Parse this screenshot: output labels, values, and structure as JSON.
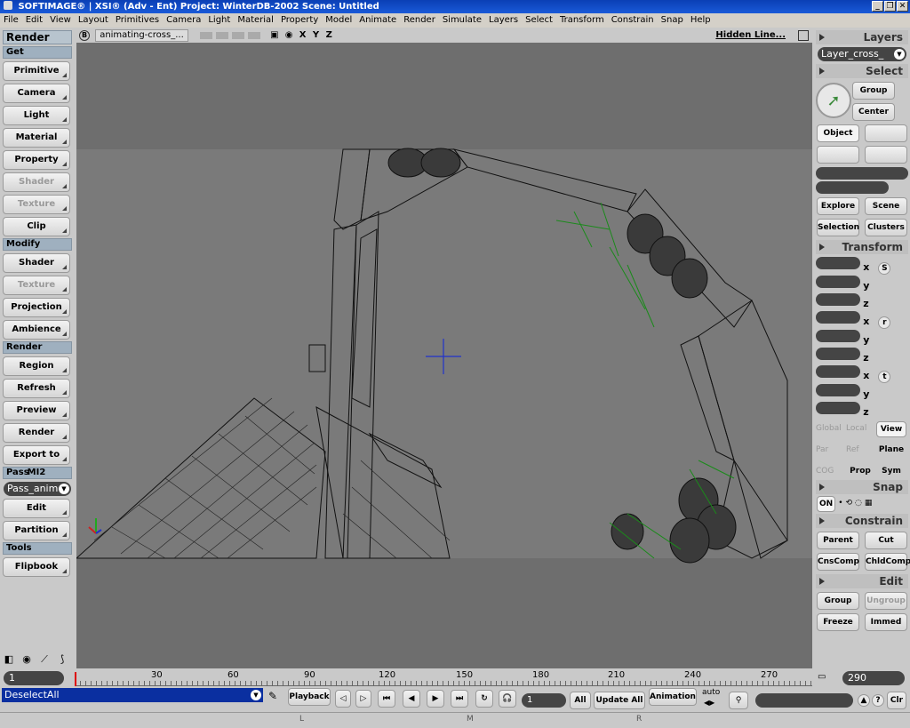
{
  "title": "SOFTIMAGE® | XSI® (Adv - Ent) Project: WinterDB-2002    Scene: Untitled",
  "menu": [
    "File",
    "Edit",
    "View",
    "Layout",
    "Primitives",
    "Camera",
    "Light",
    "Material",
    "Property",
    "Model",
    "Animate",
    "Render",
    "Simulate",
    "Layers",
    "Select",
    "Transform",
    "Constrain",
    "Snap",
    "Help"
  ],
  "left": {
    "title": "Render",
    "get_header": "Get",
    "get_buttons": [
      "Primitive",
      "Camera",
      "Light",
      "Material",
      "Property",
      "Shader",
      "Texture",
      "Clip"
    ],
    "modify_header": "Modify",
    "modify_buttons": [
      "Shader",
      "Texture",
      "Projection",
      "Ambience"
    ],
    "render_header": "Render",
    "render_buttons": [
      "Region",
      "Refresh",
      "Preview",
      "Render",
      "Export to MI2"
    ],
    "pass_header": "Pass",
    "pass_value": "Pass_anim",
    "pass_buttons": [
      "Edit",
      "Partition"
    ],
    "tools_header": "Tools",
    "tools_buttons": [
      "Flipbook"
    ]
  },
  "viewport": {
    "badge": "B",
    "camera": "animating-cross_...",
    "axes": "X Y Z",
    "mode": "Hidden Line..."
  },
  "right": {
    "layers_header": "Layers",
    "layer_value": "Layer_cross_",
    "select_header": "Select",
    "group": "Group",
    "center": "Center",
    "object": "Object",
    "explore": "Explore",
    "scene": "Scene",
    "selection": "Selection",
    "clusters": "Clusters",
    "transform_header": "Transform",
    "axis_x": "x",
    "axis_y": "y",
    "axis_z": "z",
    "s": "S",
    "r": "r",
    "t": "t",
    "global": "Global",
    "local": "Local",
    "view": "View",
    "par": "Par",
    "ref": "Ref",
    "plane": "Plane",
    "cog": "COG",
    "prop": "Prop",
    "sym": "Sym",
    "snap_header": "Snap",
    "snap_on": "ON",
    "constrain_header": "Constrain",
    "parent": "Parent",
    "cut": "Cut",
    "cnscomp": "CnsComp",
    "chldcomp": "ChldComp",
    "edit_header": "Edit",
    "edit_group": "Group",
    "ungroup": "Ungroup",
    "freeze": "Freeze",
    "immed": "Immed"
  },
  "timeline": {
    "start": "1",
    "end": "290",
    "ticks": [
      "30",
      "60",
      "90",
      "120",
      "150",
      "180",
      "210",
      "240",
      "270"
    ]
  },
  "bottom": {
    "command": "DeselectAll",
    "playback": "Playback",
    "frame": "1",
    "all": "All",
    "update_all": "Update All",
    "animation": "Animation",
    "auto": "auto",
    "clr": "Clr"
  },
  "status": {
    "l": "L",
    "m": "M",
    "r": "R"
  }
}
